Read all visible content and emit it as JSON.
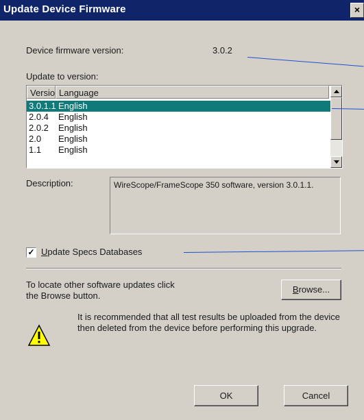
{
  "window": {
    "title": "Update Device Firmware",
    "close_glyph": "×"
  },
  "firmware": {
    "label": "Device firmware version:",
    "value": "3.0.2"
  },
  "update": {
    "label": "Update to version:",
    "columns": [
      "Version",
      "Language"
    ],
    "rows": [
      {
        "version": "3.0.1.1",
        "language": "English",
        "selected": true
      },
      {
        "version": "2.0.4",
        "language": "English",
        "selected": false
      },
      {
        "version": "2.0.2",
        "language": "English",
        "selected": false
      },
      {
        "version": "2.0",
        "language": "English",
        "selected": false
      },
      {
        "version": "1.1",
        "language": "English",
        "selected": false
      }
    ]
  },
  "description": {
    "label": "Description:",
    "text": "WireScope/FrameScope 350 software, version 3.0.1.1."
  },
  "specs": {
    "checkbox_checked": true,
    "checkbox_glyph": "✓",
    "label": "Update Specs Databases"
  },
  "browse": {
    "text": "To locate other software updates click the Browse button.",
    "button_label": "Browse..."
  },
  "warning": {
    "icon": "warning-icon",
    "text": "It is recommended that all test results be uploaded from the device then deleted from the device before performing this upgrade."
  },
  "buttons": {
    "ok_label": "OK",
    "cancel_label": "Cancel"
  },
  "colors": {
    "titlebar": "#10246a",
    "selection": "#0f7a7a",
    "annotation_line": "#1f4fcf",
    "dialog_face": "#d4d0c8"
  }
}
